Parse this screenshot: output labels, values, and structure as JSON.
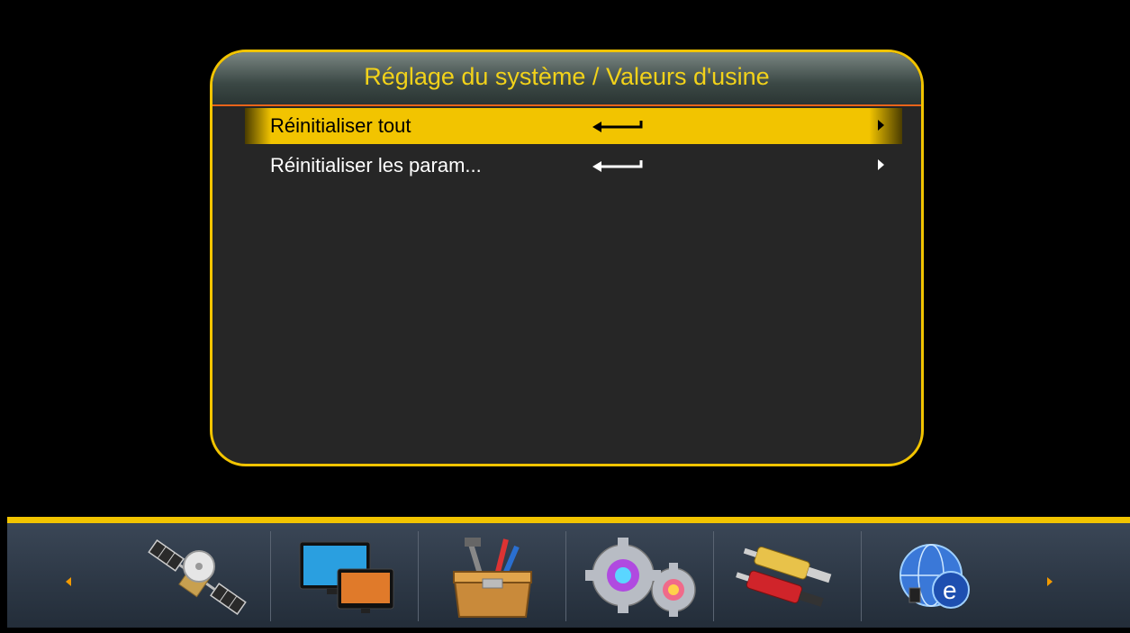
{
  "panel": {
    "title": "Réglage du système / Valeurs d'usine",
    "items": [
      {
        "label": "Réinitialiser tout",
        "selected": true
      },
      {
        "label": "Réinitialiser les param...",
        "selected": false
      }
    ]
  },
  "bottom_bar": {
    "icons": [
      "satellite-icon",
      "tv-monitors-icon",
      "toolbox-icon",
      "gears-icon",
      "av-cable-icon",
      "internet-globe-icon"
    ],
    "selected_index": null
  },
  "colors": {
    "accent": "#f2c400",
    "title": "#f2d21a",
    "divider": "#e8641a"
  }
}
